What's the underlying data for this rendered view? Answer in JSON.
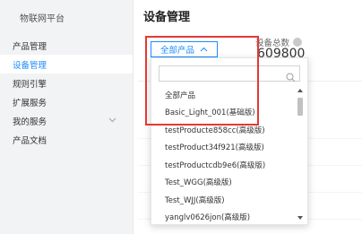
{
  "sidebar": {
    "brand": "物联网平台",
    "items": [
      {
        "label": "产品管理",
        "active": false,
        "has_chevron": false
      },
      {
        "label": "设备管理",
        "active": true,
        "has_chevron": false
      },
      {
        "label": "规则引擎",
        "active": false,
        "has_chevron": false
      },
      {
        "label": "扩展服务",
        "active": false,
        "has_chevron": false
      },
      {
        "label": "我的服务",
        "active": false,
        "has_chevron": true
      },
      {
        "label": "产品文档",
        "active": false,
        "has_chevron": false
      }
    ]
  },
  "main": {
    "title": "设备管理",
    "product_select": {
      "value": "全部产品",
      "icon": "chevron-up-icon"
    },
    "stats": {
      "total_label": "设备总数",
      "total_value": "609800",
      "icon": "info-icon"
    }
  },
  "dropdown": {
    "search_placeholder": "",
    "options": [
      "全部产品",
      "Basic_Light_001(基础版)",
      "testProducte858cc(高级版)",
      "testProduct34f921(高级版)",
      "testProductcdb9e6(高级版)",
      "Test_WGG(高级版)",
      "Test_WJJ(高级版)",
      "yanglv0626jon(高级版)"
    ]
  },
  "colors": {
    "accent": "#1a8cff",
    "highlight": "#e53935",
    "sidebar_bg": "#f2f3f5"
  }
}
